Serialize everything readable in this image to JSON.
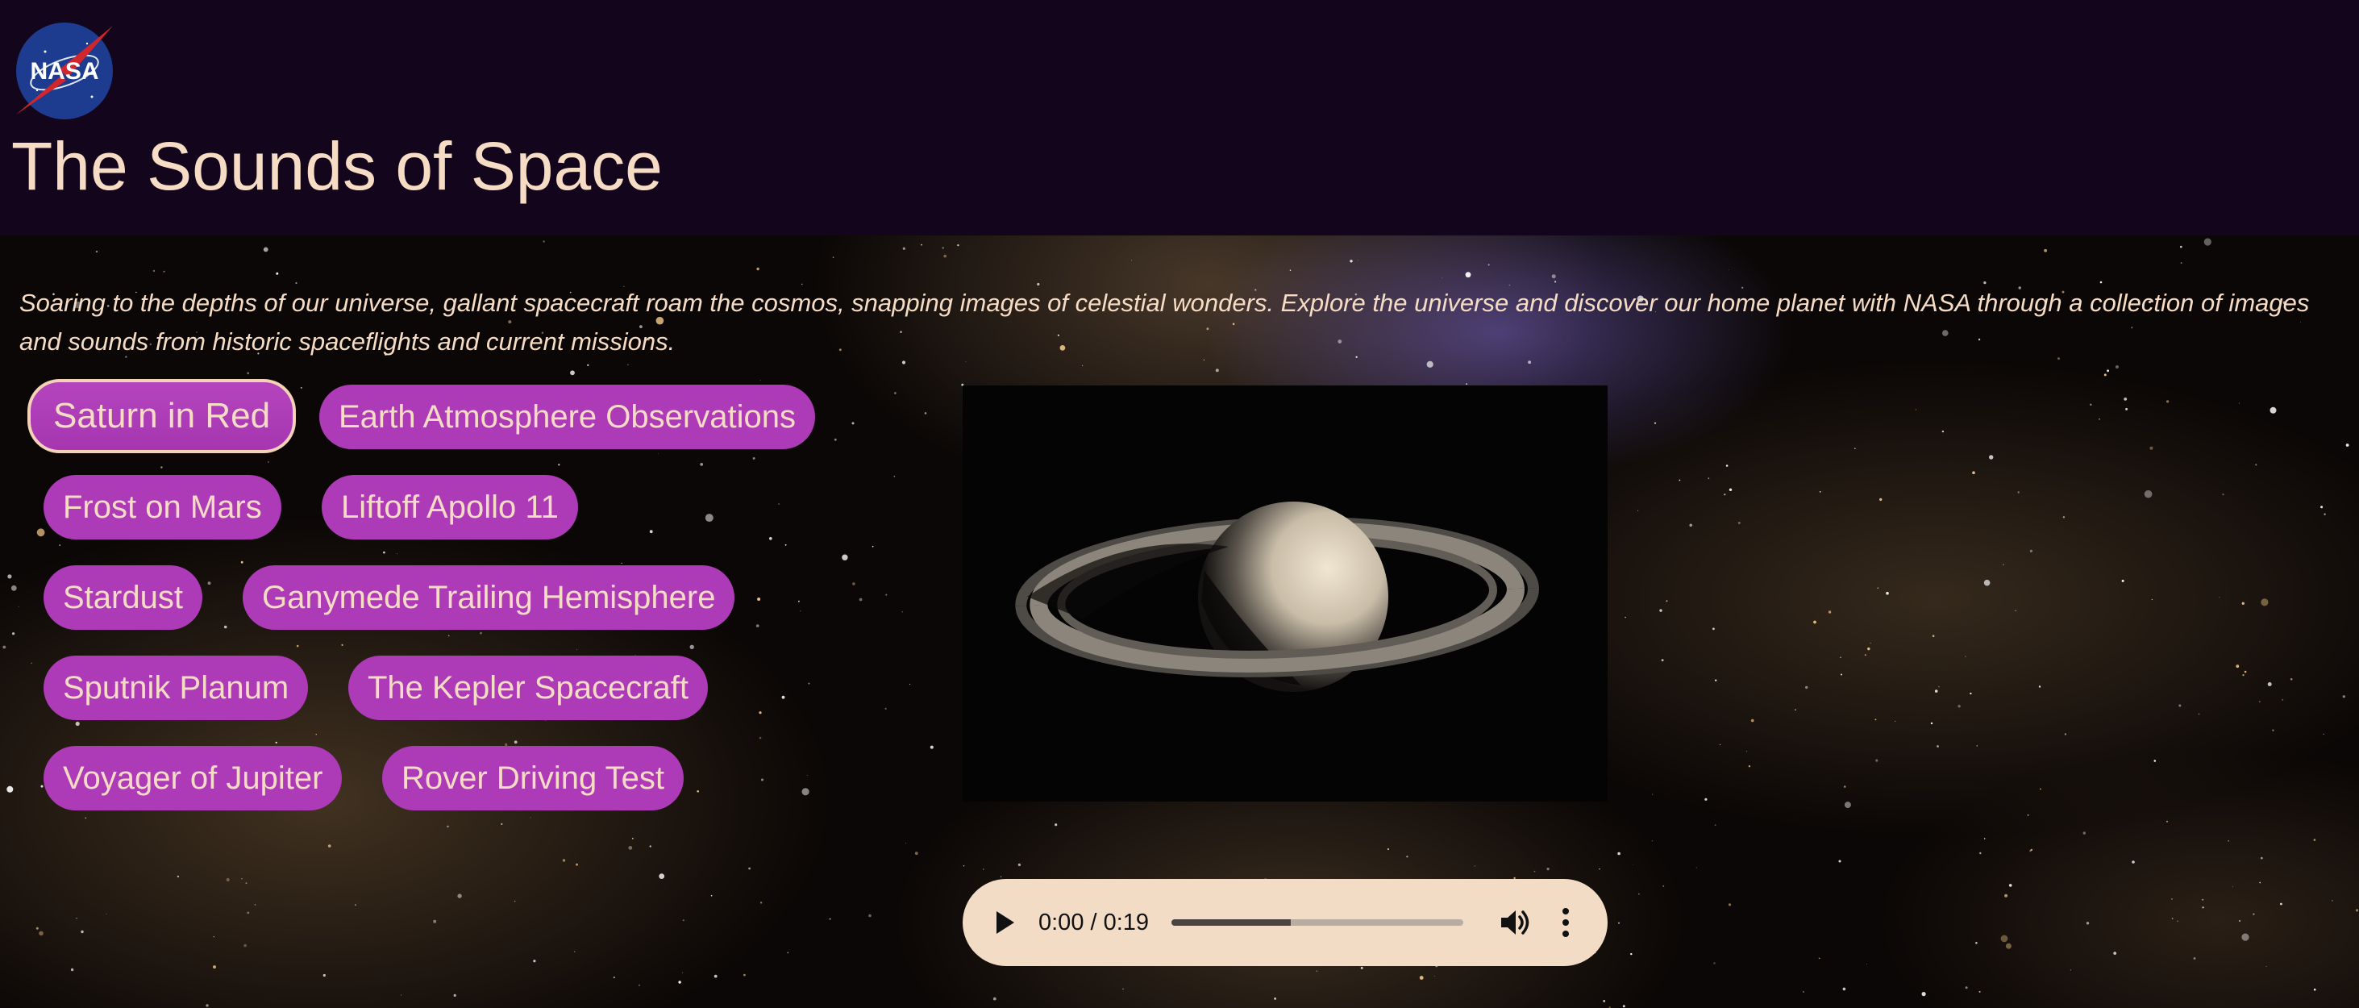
{
  "header": {
    "logo_text": "NASA",
    "title": "The Sounds of Space"
  },
  "intro": {
    "text": "Soaring to the depths of our universe, gallant spacecraft roam the cosmos, snapping images of celestial wonders. Explore the universe and discover our home planet with NASA through a collection of images and sounds from historic spaceflights and current missions."
  },
  "sounds": [
    {
      "label": "Saturn in Red"
    },
    {
      "label": "Earth Atmosphere Observations"
    },
    {
      "label": "Frost on Mars"
    },
    {
      "label": "Liftoff Apollo 11"
    },
    {
      "label": "Stardust"
    },
    {
      "label": "Ganymede Trailing Hemisphere"
    },
    {
      "label": "Sputnik Planum"
    },
    {
      "label": "The Kepler Spacecraft"
    },
    {
      "label": "Voyager of Jupiter"
    },
    {
      "label": "Rover Driving Test"
    }
  ],
  "selected_sound": "Saturn in Red",
  "image": {
    "subject": "saturn"
  },
  "audio": {
    "time": "0:00 / 0:19",
    "buffered_fraction": 0.41,
    "icons": [
      "play-icon",
      "volume-icon",
      "more-options-icon"
    ]
  },
  "colors": {
    "header_bg": "#13051b",
    "title_text": "#f6dcc4",
    "button_bg": "#ad3ab7",
    "button_text": "#f6dcc4",
    "player_bg": "#f2dcc6"
  }
}
